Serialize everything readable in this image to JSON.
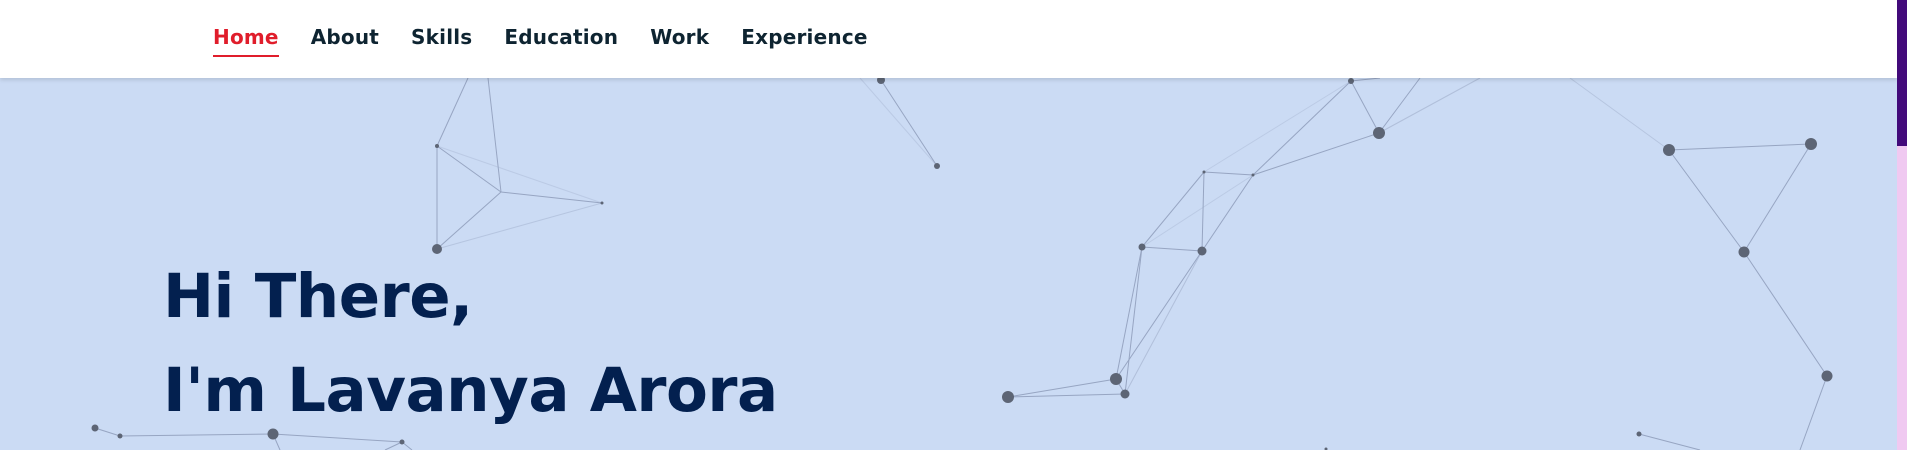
{
  "nav": {
    "items": [
      {
        "label": "Home",
        "active": true
      },
      {
        "label": "About",
        "active": false
      },
      {
        "label": "Skills",
        "active": false
      },
      {
        "label": "Education",
        "active": false
      },
      {
        "label": "Work",
        "active": false
      },
      {
        "label": "Experience",
        "active": false
      }
    ]
  },
  "hero": {
    "greeting": "Hi There,",
    "name_line": "I'm Lavanya Arora"
  },
  "colors": {
    "background": "#cbdbf4",
    "nav_active": "#e01d2b",
    "nav_text": "#0e2431",
    "hero_text": "#03204f",
    "scrollbar_thumb": "#420a7a",
    "scrollbar_track": "#f0c9f1"
  }
}
